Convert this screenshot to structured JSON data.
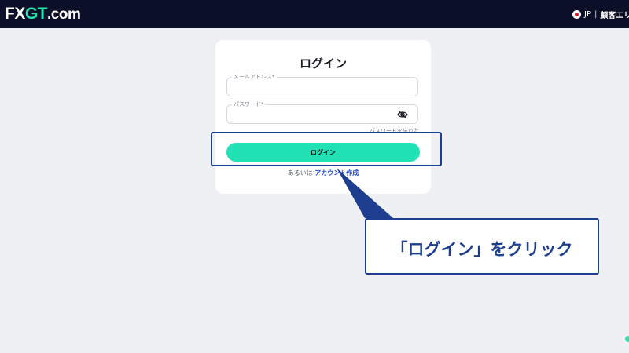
{
  "header": {
    "logo": {
      "fx": "FX",
      "gt": "GT",
      "dotcom": ".com"
    },
    "language": "JP",
    "separator": "|",
    "client_area_label": "顧客エリ"
  },
  "login_form": {
    "title": "ログイン",
    "email_label": "メールアドレス*",
    "email_value": "",
    "password_label": "パスワード*",
    "password_value": "",
    "forgot_password": "パスワードを忘れた",
    "login_button": "ログイン",
    "alt_prefix": "あるいは",
    "create_account": "アカウント作成"
  },
  "annotation": {
    "callout_text": "「ログイン」をクリック",
    "highlight_color": "#1e3f8f"
  },
  "colors": {
    "topbar": "#0b0f27",
    "accent": "#20e2b5",
    "background": "#eef0f4",
    "link": "#1d4ed8"
  }
}
